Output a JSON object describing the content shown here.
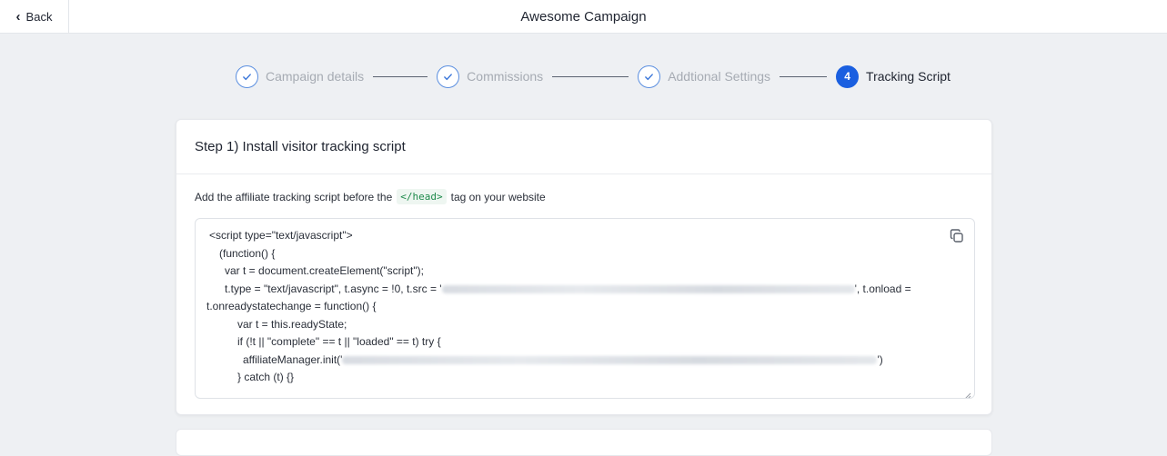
{
  "header": {
    "back_label": "Back",
    "title": "Awesome Campaign"
  },
  "stepper": {
    "steps": [
      {
        "label": "Campaign details",
        "state": "completed"
      },
      {
        "label": "Commissions",
        "state": "completed"
      },
      {
        "label": "Addtional Settings",
        "state": "completed"
      },
      {
        "label": "Tracking Script",
        "state": "active",
        "number": "4"
      }
    ]
  },
  "step1": {
    "title": "Step 1) Install visitor tracking script",
    "instruction_before": "Add the affiliate tracking script before the",
    "instruction_tag": "</head>",
    "instruction_after": "tag on your website",
    "code": {
      "line1": "<script type=\"text/javascript\">",
      "line2": "(function() {",
      "line3": "var t = document.createElement(\"script\");",
      "line4a": "t.type = \"text/javascript\", t.async = !0, t.src = '",
      "line4b": "', t.onload =",
      "line5": "t.onreadystatechange = function() {",
      "line6": "var t = this.readyState;",
      "line7": "if (!t || \"complete\" == t || \"loaded\" == t) try {",
      "line8a": "affiliateManager.init('",
      "line8b": "')",
      "line9": "} catch (t) {}"
    }
  },
  "icons": {
    "back": "chevron-left-icon",
    "step_done": "check-icon",
    "copy": "copy-icon",
    "resize": "resize-handle-icon"
  },
  "colors": {
    "accent": "#1a5fe0",
    "completed_step_border": "#5b8fe0",
    "tag_text": "#1f8a4c",
    "page_bg": "#eef0f3"
  }
}
